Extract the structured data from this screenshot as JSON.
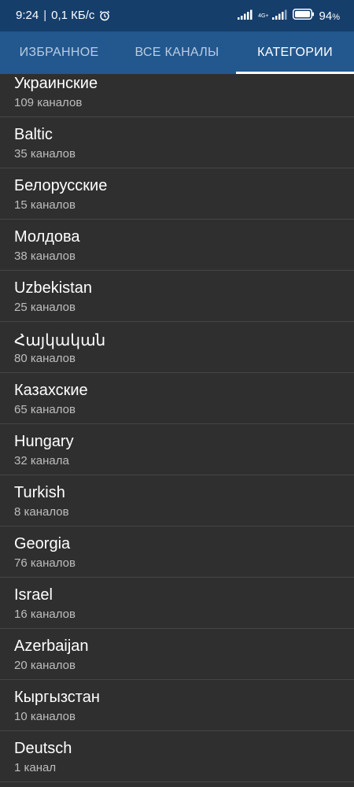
{
  "status_bar": {
    "time": "9:24",
    "separator": "|",
    "speed": "0,1 КБ/с",
    "network": "4G+",
    "battery": "94",
    "battery_unit": "%"
  },
  "tabs": [
    {
      "label": "ИЗБРАННОЕ",
      "active": false
    },
    {
      "label": "ВСЕ КАНАЛЫ",
      "active": false
    },
    {
      "label": "КАТЕГОРИИ",
      "active": true
    }
  ],
  "categories": [
    {
      "name": "Украинские",
      "count": "109 каналов"
    },
    {
      "name": "Baltic",
      "count": "35 каналов"
    },
    {
      "name": "Белорусские",
      "count": "15 каналов"
    },
    {
      "name": "Молдова",
      "count": "38 каналов"
    },
    {
      "name": "Uzbekistan",
      "count": "25 каналов"
    },
    {
      "name": "Հայկական",
      "count": "80 каналов"
    },
    {
      "name": "Казахские",
      "count": "65 каналов"
    },
    {
      "name": "Hungary",
      "count": "32 канала"
    },
    {
      "name": "Turkish",
      "count": "8 каналов"
    },
    {
      "name": "Georgia",
      "count": "76 каналов"
    },
    {
      "name": "Israel",
      "count": "16 каналов"
    },
    {
      "name": "Azerbaijan",
      "count": "20 каналов"
    },
    {
      "name": "Кыргызстан",
      "count": "10 каналов"
    },
    {
      "name": "Deutsch",
      "count": "1 канал"
    }
  ],
  "colors": {
    "status_bar_bg": "#163e6b",
    "tab_bar_bg": "#23588e",
    "list_bg": "#2f2f2f",
    "divider": "#454545",
    "indicator": "#ffffff"
  }
}
